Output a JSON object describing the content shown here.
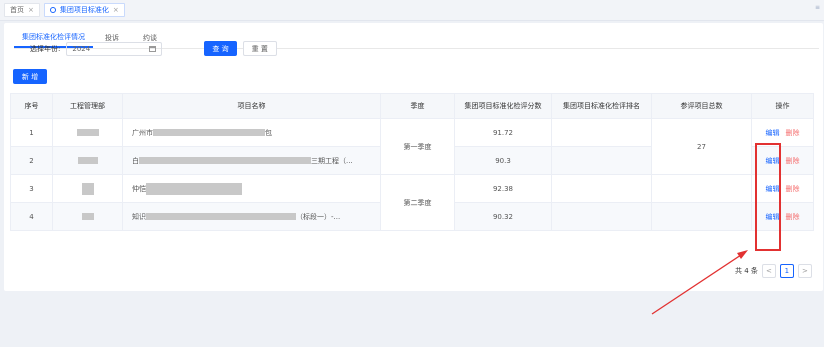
{
  "window_tabs": [
    {
      "label": "首页",
      "close": "×"
    },
    {
      "label": "集团项目标准化",
      "close": "×"
    }
  ],
  "sub_tabs": [
    "集团标准化检评情况",
    "投诉",
    "约谈"
  ],
  "filter": {
    "year_label": "选择年份:",
    "year_value": "2024",
    "query": "查 询",
    "reset": "重 置"
  },
  "add_button": "新 增",
  "table": {
    "headers": [
      "序号",
      "工程管理部",
      "项目名称",
      "季度",
      "集团项目标准化检评分数",
      "集团项目标准化检评排名",
      "参评项目总数",
      "操作"
    ],
    "rows": [
      {
        "no": "1",
        "name_prefix": "广州市",
        "name_suffix": "包",
        "score": "91.72"
      },
      {
        "no": "2",
        "name_prefix": "白",
        "name_suffix": "三期工程（...",
        "score": "90.3"
      },
      {
        "no": "3",
        "name_prefix": "仲恺",
        "name_suffix": "",
        "score": "92.38"
      },
      {
        "no": "4",
        "name_prefix": "知识",
        "name_suffix": "（标段一）-...",
        "score": "90.32"
      }
    ],
    "quarters": [
      "第一季度",
      "第二季度"
    ],
    "total_projects": "27",
    "edit": "编辑",
    "delete": "删除"
  },
  "pagination": {
    "total": "共 4 条",
    "page": "1",
    "prev": "<",
    "next": ">"
  }
}
